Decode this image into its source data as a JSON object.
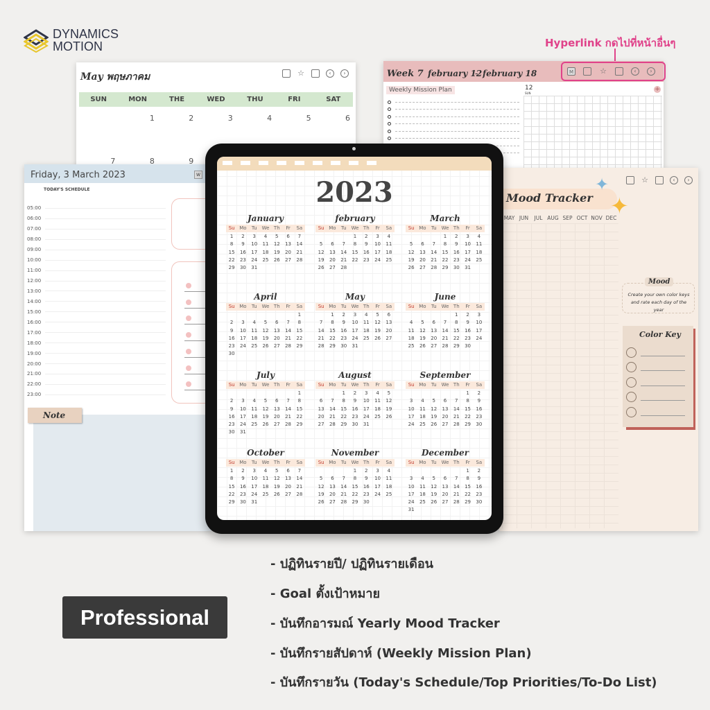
{
  "brand": {
    "line1": "DYNAMICS",
    "line2": "MOTION"
  },
  "annotation": {
    "hyperlink_note": "Hyperlink กดไปที่หน้าอื่นๆ",
    "color": "#e0428a"
  },
  "monthly": {
    "title": "May พฤษภาคม",
    "weekdays": [
      "SUN",
      "MON",
      "THE",
      "WED",
      "THU",
      "FRI",
      "SAT"
    ],
    "row1": [
      "",
      "1",
      "2",
      "3",
      "4",
      "5",
      "6"
    ],
    "row2": [
      "7",
      "8",
      "9"
    ],
    "header_color": "#d4e8cf"
  },
  "weekly": {
    "week": "Week 7",
    "range_start": "february 12",
    "range_end": "february 18",
    "mission_label": "Weekly Mission Plan",
    "day_num": "12",
    "day_name": "SUN",
    "m_button": "M",
    "header_color": "#e8bcbc"
  },
  "daily": {
    "title": "Friday, 3 March 2023",
    "w_button": "W",
    "schedule_label": "TODAY'S SCHEDULE",
    "times": [
      "05:00",
      "06:00",
      "07:00",
      "08:00",
      "09:00",
      "10:00",
      "11:00",
      "12:00",
      "13:00",
      "14:00",
      "15:00",
      "16:00",
      "17:00",
      "18:00",
      "19:00",
      "20:00",
      "21:00",
      "22:00",
      "23:00"
    ],
    "note_label": "Note",
    "header_color": "#d6e3ec"
  },
  "mood": {
    "title": "Mood Tracker",
    "months": [
      "MAY",
      "JUN",
      "JUL",
      "AUG",
      "SEP",
      "OCT",
      "NOV",
      "DEC"
    ],
    "mood_label": "Mood",
    "mood_desc": "Create your own color keys and rate each day of the year",
    "color_key_label": "Color Key"
  },
  "yearly": {
    "year": "2023",
    "weekdays": [
      "Su",
      "Mo",
      "Tu",
      "We",
      "Th",
      "Fr",
      "Sa"
    ],
    "months": [
      {
        "name": "January",
        "first_weekday": "Su",
        "days": 31
      },
      {
        "name": "february",
        "first_weekday": "We",
        "days": 28
      },
      {
        "name": "March",
        "first_weekday": "We",
        "days": 31
      },
      {
        "name": "April",
        "first_weekday": "Sa",
        "days": 30
      },
      {
        "name": "May",
        "first_weekday": "Mo",
        "days": 31
      },
      {
        "name": "June",
        "first_weekday": "Th",
        "days": 30
      },
      {
        "name": "July",
        "first_weekday": "Sa",
        "days": 31
      },
      {
        "name": "August",
        "first_weekday": "Tu",
        "days": 31
      },
      {
        "name": "September",
        "first_weekday": "Fr",
        "days": 30
      },
      {
        "name": "October",
        "first_weekday": "Su",
        "days": 31
      },
      {
        "name": "November",
        "first_weekday": "We",
        "days": 30
      },
      {
        "name": "December",
        "first_weekday": "Fr",
        "days": 31
      }
    ]
  },
  "badge": "Professional",
  "features": [
    "- ปฏิทินรายปี/ ปฏิทินรายเดือน",
    "- Goal ตั้งเป้าหมาย",
    "- บันทึกอารมณ์ Yearly Mood Tracker",
    "- บันทึกรายสัปดาห์ (Weekly Mission Plan)",
    "- บันทึกรายวัน (Today's Schedule/Top Priorities/To-Do List)"
  ]
}
